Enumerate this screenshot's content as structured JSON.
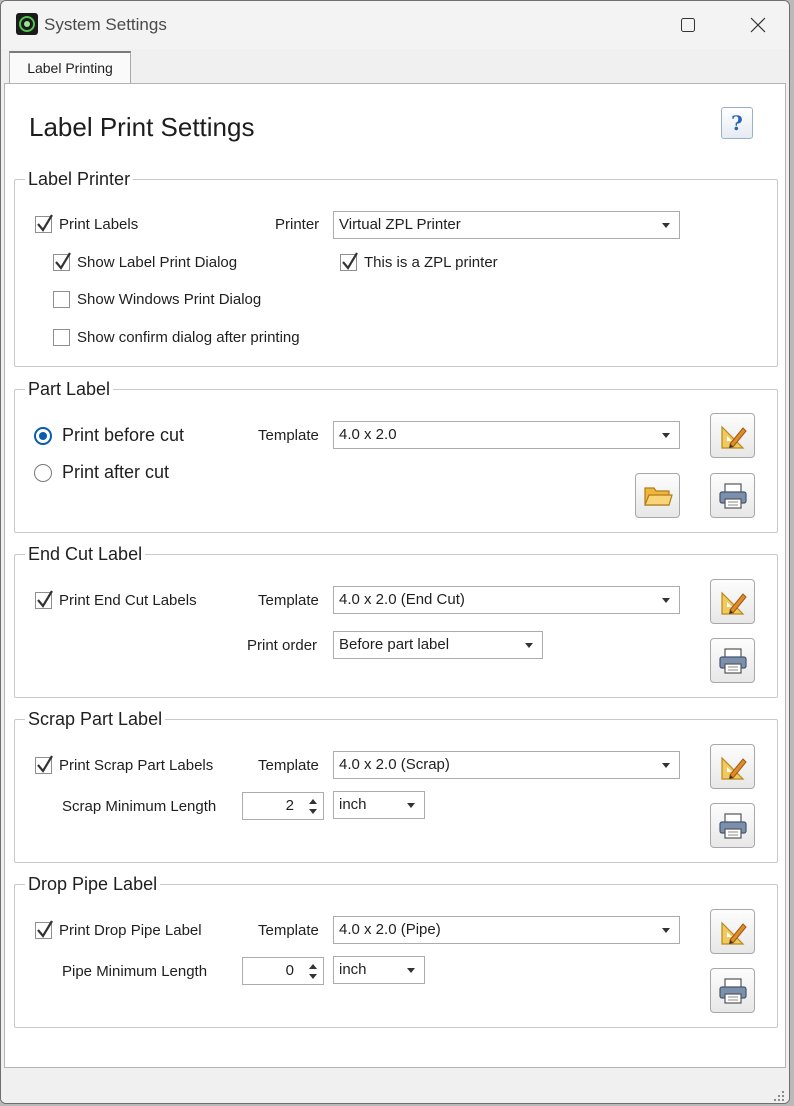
{
  "window": {
    "title": "System Settings"
  },
  "tabs": [
    {
      "label": "Label Printing"
    }
  ],
  "heading": "Label Print Settings",
  "help_button": {
    "icon": "help-icon",
    "label": "?"
  },
  "label_printer": {
    "legend": "Label Printer",
    "print_labels": {
      "label": "Print Labels",
      "checked": true
    },
    "printer_label": "Printer",
    "printer_value": "Virtual ZPL Printer",
    "show_label_print_dialog": {
      "label": "Show Label Print Dialog",
      "checked": true
    },
    "zpl_printer": {
      "label": "This is a ZPL printer",
      "checked": true
    },
    "show_windows_print_dialog": {
      "label": "Show Windows Print Dialog",
      "checked": false
    },
    "show_confirm_dialog": {
      "label": "Show confirm dialog after printing",
      "checked": false
    }
  },
  "part_label": {
    "legend": "Part Label",
    "print_before_cut": {
      "label": "Print before cut",
      "selected": true
    },
    "print_after_cut": {
      "label": "Print after cut",
      "selected": false
    },
    "template_label": "Template",
    "template_value": "4.0 x 2.0"
  },
  "end_cut_label": {
    "legend": "End Cut Label",
    "print_end_cut": {
      "label": "Print End Cut Labels",
      "checked": true
    },
    "template_label": "Template",
    "template_value": "4.0 x 2.0 (End Cut)",
    "print_order_label": "Print order",
    "print_order_value": "Before part label"
  },
  "scrap_part_label": {
    "legend": "Scrap Part Label",
    "print_scrap": {
      "label": "Print Scrap Part Labels",
      "checked": true
    },
    "template_label": "Template",
    "template_value": "4.0 x 2.0 (Scrap)",
    "min_length_label": "Scrap Minimum Length",
    "min_length_value": "2",
    "unit_value": "inch"
  },
  "drop_pipe_label": {
    "legend": "Drop Pipe Label",
    "print_drop_pipe": {
      "label": "Print Drop Pipe Label",
      "checked": true
    },
    "template_label": "Template",
    "template_value": "4.0 x 2.0 (Pipe)",
    "min_length_label": "Pipe Minimum Length",
    "min_length_value": "0",
    "unit_value": "inch"
  }
}
